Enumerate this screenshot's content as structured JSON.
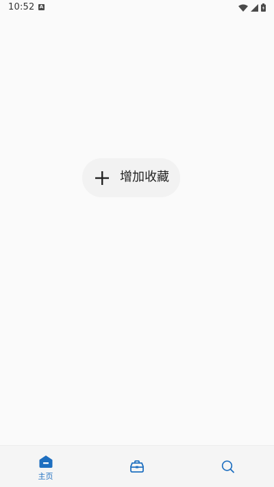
{
  "status_bar": {
    "time": "10:52",
    "notification_icon": "a-letter-icon",
    "right_icons": [
      "wifi-icon",
      "signal-icon",
      "battery-icon"
    ]
  },
  "main": {
    "add_favorite_label": "增加收藏",
    "add_favorite_icon": "plus-icon"
  },
  "bottom_nav": {
    "items": [
      {
        "label": "主页",
        "icon": "home-icon",
        "active": true
      },
      {
        "label": "",
        "icon": "toolbox-icon",
        "active": false
      },
      {
        "label": "",
        "icon": "search-icon",
        "active": false
      }
    ]
  },
  "colors": {
    "accent": "#1e6fc0",
    "background": "#fafafa",
    "pill_background": "#f2f2f2",
    "nav_background": "#f5f5f5"
  }
}
